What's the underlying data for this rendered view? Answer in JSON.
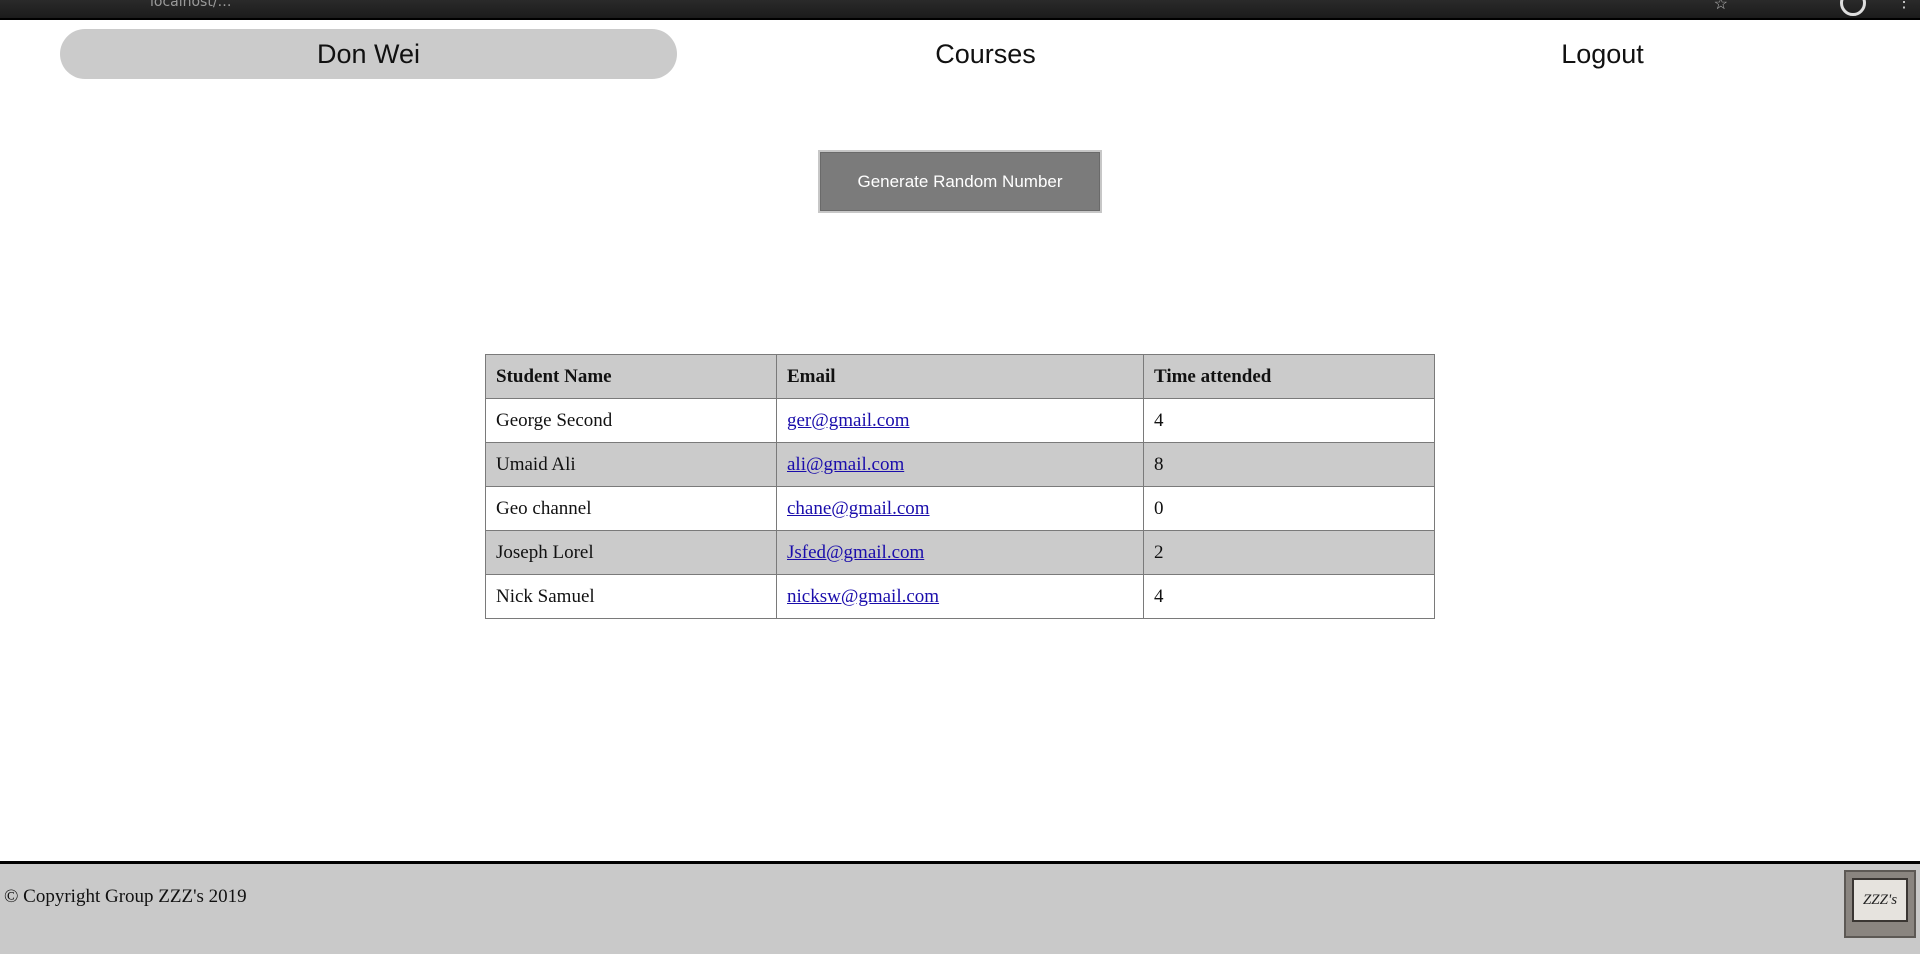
{
  "nav": {
    "user": "Don Wei",
    "courses": "Courses",
    "logout": "Logout"
  },
  "actions": {
    "generate_label": "Generate Random Number"
  },
  "table": {
    "headers": [
      "Student Name",
      "Email",
      "Time attended"
    ],
    "rows": [
      {
        "name": "George Second",
        "email": "ger@gmail.com",
        "times": "4"
      },
      {
        "name": "Umaid Ali",
        "email": "ali@gmail.com",
        "times": "8"
      },
      {
        "name": "Geo channel",
        "email": "chane@gmail.com",
        "times": "0"
      },
      {
        "name": "Joseph Lorel",
        "email": "Jsfed@gmail.com",
        "times": "2"
      },
      {
        "name": "Nick Samuel",
        "email": "nicksw@gmail.com",
        "times": "4"
      }
    ]
  },
  "footer": {
    "copyright": "© Copyright Group ZZZ's 2019",
    "logo_text": "ZZZ's"
  }
}
